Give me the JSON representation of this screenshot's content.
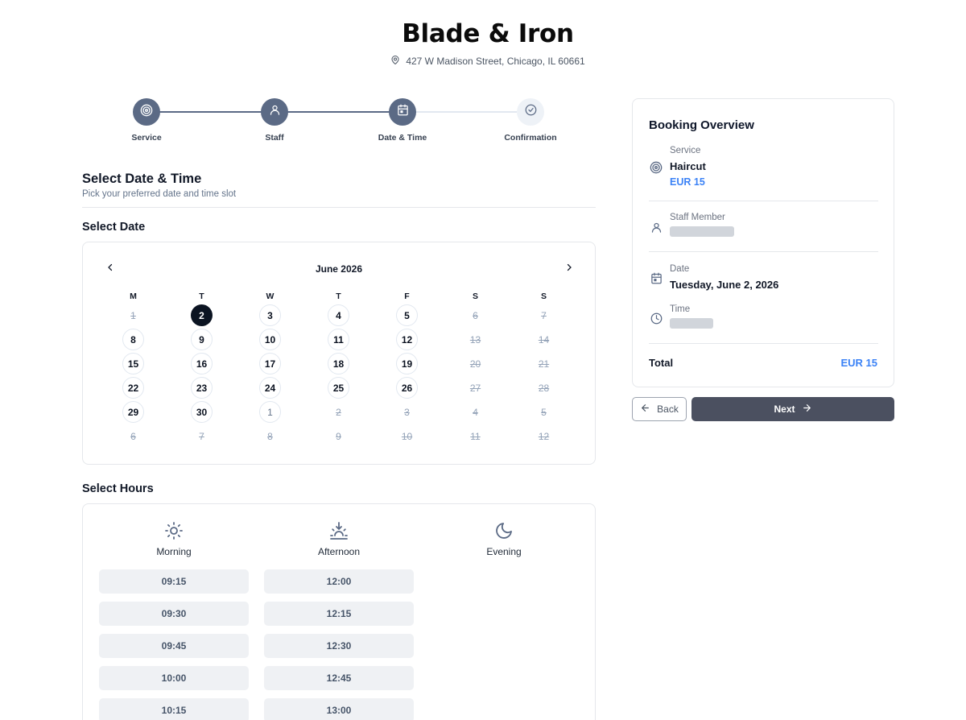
{
  "business": {
    "name": "Blade & Iron",
    "address": "427 W Madison Street, Chicago, IL 60661",
    "address_icon": "map-pin-icon"
  },
  "stepper": {
    "steps": [
      {
        "label": "Service",
        "icon": "target-icon",
        "state": "done"
      },
      {
        "label": "Staff",
        "icon": "user-icon",
        "state": "done"
      },
      {
        "label": "Date & Time",
        "icon": "calendar-icon",
        "state": "current"
      },
      {
        "label": "Confirmation",
        "icon": "check-circle-icon",
        "state": "todo"
      }
    ]
  },
  "page": {
    "title": "Select Date & Time",
    "subtitle": "Pick your preferred date and time slot"
  },
  "date_section": {
    "title": "Select Date",
    "month_label": "June 2026",
    "weekdays": [
      "M",
      "T",
      "W",
      "T",
      "F",
      "S",
      "S"
    ],
    "weeks": [
      [
        {
          "d": "1",
          "s": "disabled"
        },
        {
          "d": "2",
          "s": "selected"
        },
        {
          "d": "3",
          "s": "avail"
        },
        {
          "d": "4",
          "s": "avail"
        },
        {
          "d": "5",
          "s": "avail"
        },
        {
          "d": "6",
          "s": "disabled"
        },
        {
          "d": "7",
          "s": "disabled"
        }
      ],
      [
        {
          "d": "8",
          "s": "avail"
        },
        {
          "d": "9",
          "s": "avail"
        },
        {
          "d": "10",
          "s": "avail"
        },
        {
          "d": "11",
          "s": "avail"
        },
        {
          "d": "12",
          "s": "avail"
        },
        {
          "d": "13",
          "s": "disabled"
        },
        {
          "d": "14",
          "s": "disabled"
        }
      ],
      [
        {
          "d": "15",
          "s": "avail"
        },
        {
          "d": "16",
          "s": "avail"
        },
        {
          "d": "17",
          "s": "avail"
        },
        {
          "d": "18",
          "s": "avail"
        },
        {
          "d": "19",
          "s": "avail"
        },
        {
          "d": "20",
          "s": "disabled"
        },
        {
          "d": "21",
          "s": "disabled"
        }
      ],
      [
        {
          "d": "22",
          "s": "avail"
        },
        {
          "d": "23",
          "s": "avail"
        },
        {
          "d": "24",
          "s": "avail"
        },
        {
          "d": "25",
          "s": "avail"
        },
        {
          "d": "26",
          "s": "avail"
        },
        {
          "d": "27",
          "s": "disabled"
        },
        {
          "d": "28",
          "s": "disabled"
        }
      ],
      [
        {
          "d": "29",
          "s": "avail"
        },
        {
          "d": "30",
          "s": "avail"
        },
        {
          "d": "1",
          "s": "other-avail"
        },
        {
          "d": "2",
          "s": "disabled"
        },
        {
          "d": "3",
          "s": "disabled"
        },
        {
          "d": "4",
          "s": "disabled"
        },
        {
          "d": "5",
          "s": "disabled"
        }
      ],
      [
        {
          "d": "6",
          "s": "disabled"
        },
        {
          "d": "7",
          "s": "disabled"
        },
        {
          "d": "8",
          "s": "disabled"
        },
        {
          "d": "9",
          "s": "disabled"
        },
        {
          "d": "10",
          "s": "disabled"
        },
        {
          "d": "11",
          "s": "disabled"
        },
        {
          "d": "12",
          "s": "disabled"
        }
      ]
    ]
  },
  "hours_section": {
    "title": "Select Hours",
    "periods": [
      {
        "label": "Morning",
        "icon": "sun-icon",
        "slots": [
          "09:15",
          "09:30",
          "09:45",
          "10:00",
          "10:15"
        ]
      },
      {
        "label": "Afternoon",
        "icon": "sunset-icon",
        "slots": [
          "12:00",
          "12:15",
          "12:30",
          "12:45",
          "13:00"
        ]
      },
      {
        "label": "Evening",
        "icon": "moon-icon",
        "slots": []
      }
    ]
  },
  "overview": {
    "title": "Booking Overview",
    "service_label": "Service",
    "service_value": "Haircut",
    "service_price": "EUR 15",
    "staff_label": "Staff Member",
    "date_label": "Date",
    "date_value": "Tuesday, June 2, 2026",
    "time_label": "Time",
    "total_label": "Total",
    "total_value": "EUR 15"
  },
  "actions": {
    "back_label": "Back",
    "next_label": "Next"
  },
  "colors": {
    "accent": "#3b82f6",
    "step_done": "#5b6a85",
    "selected_day": "#0b1422",
    "next_button": "#4b5060"
  }
}
